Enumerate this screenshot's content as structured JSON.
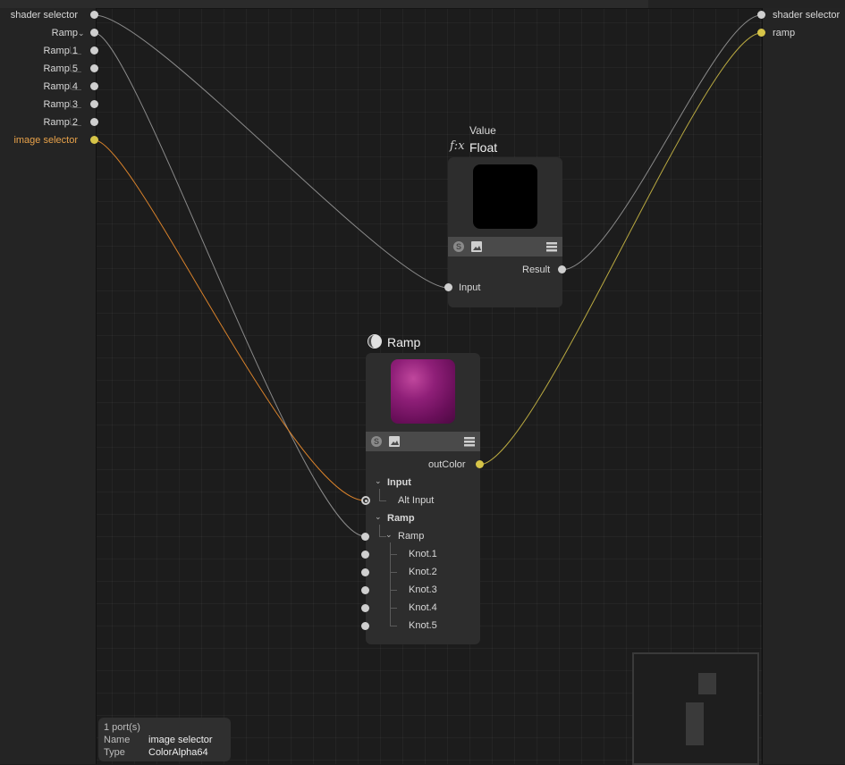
{
  "left_ports": [
    {
      "label": "shader selector",
      "color": "#d8d8d8",
      "dot": "white"
    },
    {
      "label": "Ramp",
      "color": "#d8d8d8",
      "dot": "white",
      "expanded": true
    },
    {
      "label": "Ramp.1",
      "color": "#d8d8d8",
      "dot": "white",
      "child": true
    },
    {
      "label": "Ramp.5",
      "color": "#d8d8d8",
      "dot": "white",
      "child": true
    },
    {
      "label": "Ramp.4",
      "color": "#d8d8d8",
      "dot": "white",
      "child": true
    },
    {
      "label": "Ramp.3",
      "color": "#d8d8d8",
      "dot": "white",
      "child": true
    },
    {
      "label": "Ramp.2",
      "color": "#d8d8d8",
      "dot": "white",
      "child": true
    },
    {
      "label": "image selector",
      "color": "#e8a24a",
      "dot": "yellow"
    }
  ],
  "right_ports": [
    {
      "label": "shader selector",
      "dot": "white"
    },
    {
      "label": "ramp",
      "dot": "yellow"
    }
  ],
  "float_node": {
    "subtitle": "Value",
    "title": "Float",
    "icon": "fx-icon",
    "output": "Result",
    "input": "Input"
  },
  "ramp_node": {
    "title": "Ramp",
    "icon": "ramp-sphere-icon",
    "output": "outColor",
    "group_input": "Input",
    "alt_input": "Alt Input",
    "group_ramp": "Ramp",
    "ramp_child": "Ramp",
    "knots": [
      "Knot.1",
      "Knot.2",
      "Knot.3",
      "Knot.4",
      "Knot.5"
    ]
  },
  "tooltip": {
    "count": "1 port(s)",
    "name_key": "Name",
    "name_val": "image selector",
    "type_key": "Type",
    "type_val": "ColorAlpha64"
  },
  "colors": {
    "accent_orange": "#e8a24a",
    "port_yellow": "#d6c448",
    "wire_gray": "#8a8a8a"
  }
}
